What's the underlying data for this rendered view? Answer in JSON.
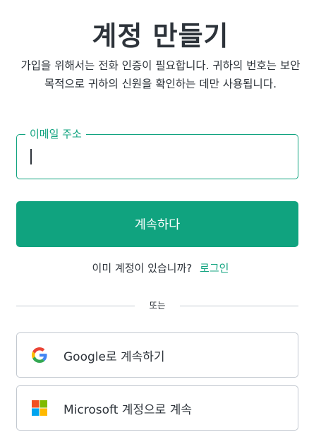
{
  "title": "계정 만들기",
  "description": "가입을 위해서는 전화 인증이 필요합니다. 귀하의 번호는 보안 목적으로 귀하의 신원을 확인하는 데만 사용됩니다.",
  "email_field": {
    "label": "이메일 주소",
    "value": ""
  },
  "continue_button": "계속하다",
  "login_prompt": {
    "text": "이미 계정이 있습니까?",
    "link": "로그인"
  },
  "divider_text": "또는",
  "social": {
    "google": {
      "label": "Google로 계속하기",
      "icon": "google-icon"
    },
    "microsoft": {
      "label": "Microsoft 계정으로 계속",
      "icon": "microsoft-icon"
    }
  },
  "colors": {
    "accent": "#10a37f",
    "text": "#2d333a",
    "border": "#c2c8d0"
  }
}
